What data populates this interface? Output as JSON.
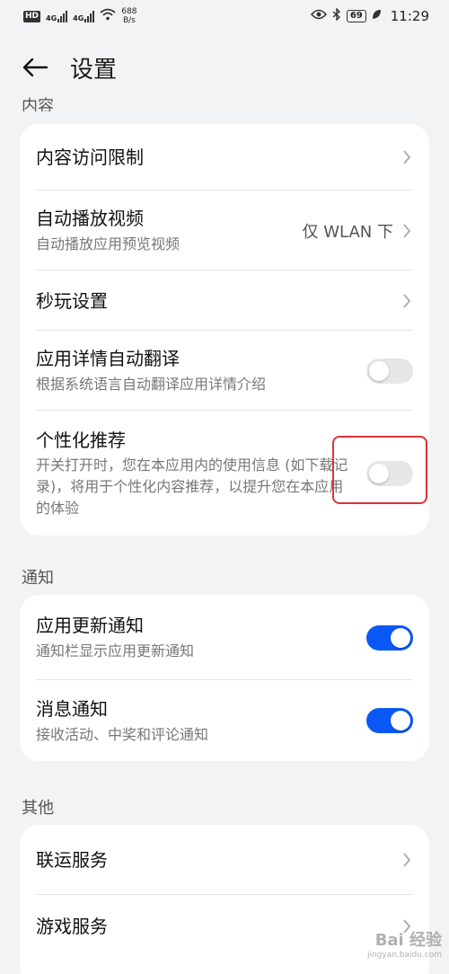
{
  "status_bar": {
    "hd": "HD",
    "net1": "4G",
    "net2": "4G",
    "speed_value": "688",
    "speed_unit": "B/s",
    "battery": "69",
    "time": "11:29"
  },
  "header": {
    "title": "设置"
  },
  "sections": {
    "content": {
      "label": "内容",
      "items": [
        {
          "title": "内容访问限制"
        },
        {
          "title": "自动播放视频",
          "subtitle": "自动播放应用预览视频",
          "value": "仅 WLAN 下"
        },
        {
          "title": "秒玩设置"
        },
        {
          "title": "应用详情自动翻译",
          "subtitle": "根据系统语言自动翻译应用详情介绍",
          "toggle": false
        },
        {
          "title": "个性化推荐",
          "subtitle": "开关打开时，您在本应用内的使用信息 (如下载记录)，将用于个性化内容推荐，以提升您在本应用的体验",
          "toggle": false
        }
      ]
    },
    "notify": {
      "label": "通知",
      "items": [
        {
          "title": "应用更新通知",
          "subtitle": "通知栏显示应用更新通知",
          "toggle": true
        },
        {
          "title": "消息通知",
          "subtitle": "接收活动、中奖和评论通知",
          "toggle": true
        }
      ]
    },
    "other": {
      "label": "其他",
      "items": [
        {
          "title": "联运服务"
        },
        {
          "title": "游戏服务"
        }
      ]
    }
  },
  "watermark": {
    "text": "Bai 经验",
    "sub": "jingyan.baidu.com"
  },
  "colors": {
    "accent": "#0a59f7",
    "highlight": "#d8343a",
    "background": "#f1f3f5"
  },
  "icons": [
    "back-arrow-icon",
    "chevron-right-icon",
    "wifi-icon",
    "eye-icon",
    "bluetooth-icon",
    "battery-icon",
    "leaf-icon"
  ]
}
